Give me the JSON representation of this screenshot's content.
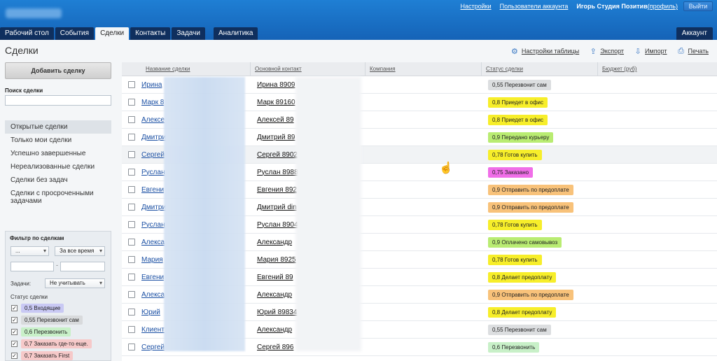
{
  "header": {
    "links": [
      "Настройки",
      "Пользователи аккаунта"
    ],
    "user": "Игорь Студия Позитив",
    "profile": "(профиль)",
    "logout": "Выйти"
  },
  "tabs": [
    "Рабочий стол",
    "События",
    "Сделки",
    "Контакты",
    "Задачи",
    "Аналитика"
  ],
  "active_tab": "Сделки",
  "account_tab": "Аккаунт",
  "page_title": "Сделки",
  "actions": {
    "table_settings": "Настройки таблицы",
    "export": "Экспорт",
    "import": "Импорт",
    "print": "Печать"
  },
  "sidebar": {
    "add_button": "Добавить сделку",
    "search_label": "Поиск сделки",
    "filters": [
      "Открытые сделки",
      "Только мои сделки",
      "Успешно завершенные",
      "Нереализованные сделки",
      "Сделки без задач",
      "Сделки с просроченными задачами"
    ],
    "filter_box": {
      "title": "Фильтр по сделкам",
      "select1": "...",
      "select2": "За все время",
      "tasks_label": "Задачи:",
      "tasks_value": "Не учитывать",
      "status_label": "Статус сделки",
      "statuses": [
        {
          "label": "0,5 Входящие",
          "color": "#c9c9f4"
        },
        {
          "label": "0,55 Перезвонит сам",
          "color": "#d8dadc"
        },
        {
          "label": "0,6 Перезвонить",
          "color": "#c8f0c8"
        },
        {
          "label": "0,7 Заказать где-то еще.",
          "color": "#f6c9c9"
        },
        {
          "label": "0,7 Заказать First",
          "color": "#f6c9c9"
        }
      ]
    }
  },
  "table": {
    "headers": [
      "Название сделки",
      "Основной контакт",
      "Компания",
      "Статус сделки",
      "Бюджет (руб)"
    ],
    "rows": [
      {
        "name": "Ирина",
        "contact": "Ирина 8909",
        "status": "0,55 Перезвонит сам",
        "color": "#dcdee0"
      },
      {
        "name": "Марк 8",
        "contact": "Марк 89160",
        "status": "0,8 Приедет в офис",
        "color": "#f7ee2a"
      },
      {
        "name": "Алексе",
        "contact": "Алексей 89",
        "status": "0,8 Приедет в офис",
        "color": "#f7ee2a"
      },
      {
        "name": "Дмитри",
        "contact": "Дмитрий 89",
        "status": "0,9 Передано курьеру",
        "color": "#b9ec72"
      },
      {
        "name": "Сергей",
        "contact": "Сергей 8902",
        "status": "0,78 Готов купить",
        "color": "#f7ee2a"
      },
      {
        "name": "Руслан",
        "contact": "Руслан 8988",
        "status": "0,75 Заказано",
        "color": "#f06ee8"
      },
      {
        "name": "Евгени",
        "contact": "Евгения 892",
        "status": "0,9 Отправить по предоплате",
        "color": "#f8c27a"
      },
      {
        "name": "Дмитри",
        "contact": "Дмитрий din",
        "status": "0,9 Отправить по предоплате",
        "color": "#f8c27a"
      },
      {
        "name": "Руслан",
        "contact": "Руслан 8904",
        "status": "0,78 Готов купить",
        "color": "#f7ee2a"
      },
      {
        "name": "Алекса",
        "contact": "Александр",
        "status": "0,9 Оплачено самовывоз",
        "color": "#b9ec72"
      },
      {
        "name": "Мария",
        "contact": "Мария 8925",
        "status": "0,78 Готов купить",
        "color": "#f7ee2a"
      },
      {
        "name": "Евгени",
        "contact": "Евгений 89",
        "status": "0,8 Делает предоплату",
        "color": "#f7ee2a"
      },
      {
        "name": "Алекса",
        "contact": "Александр",
        "status": "0,9 Отправить по предоплате",
        "color": "#f8c27a"
      },
      {
        "name": "Юрий",
        "contact": "Юрий 89834",
        "status": "0,8 Делает предоплату",
        "color": "#f7ee2a"
      },
      {
        "name": "Клиент",
        "contact": "Александр",
        "status": "0,55 Перезвонит сам",
        "color": "#dcdee0"
      },
      {
        "name": "Сергей",
        "contact": "Сергей 896",
        "status": "0,6 Перезвонить",
        "color": "#c8f0c8"
      }
    ]
  }
}
